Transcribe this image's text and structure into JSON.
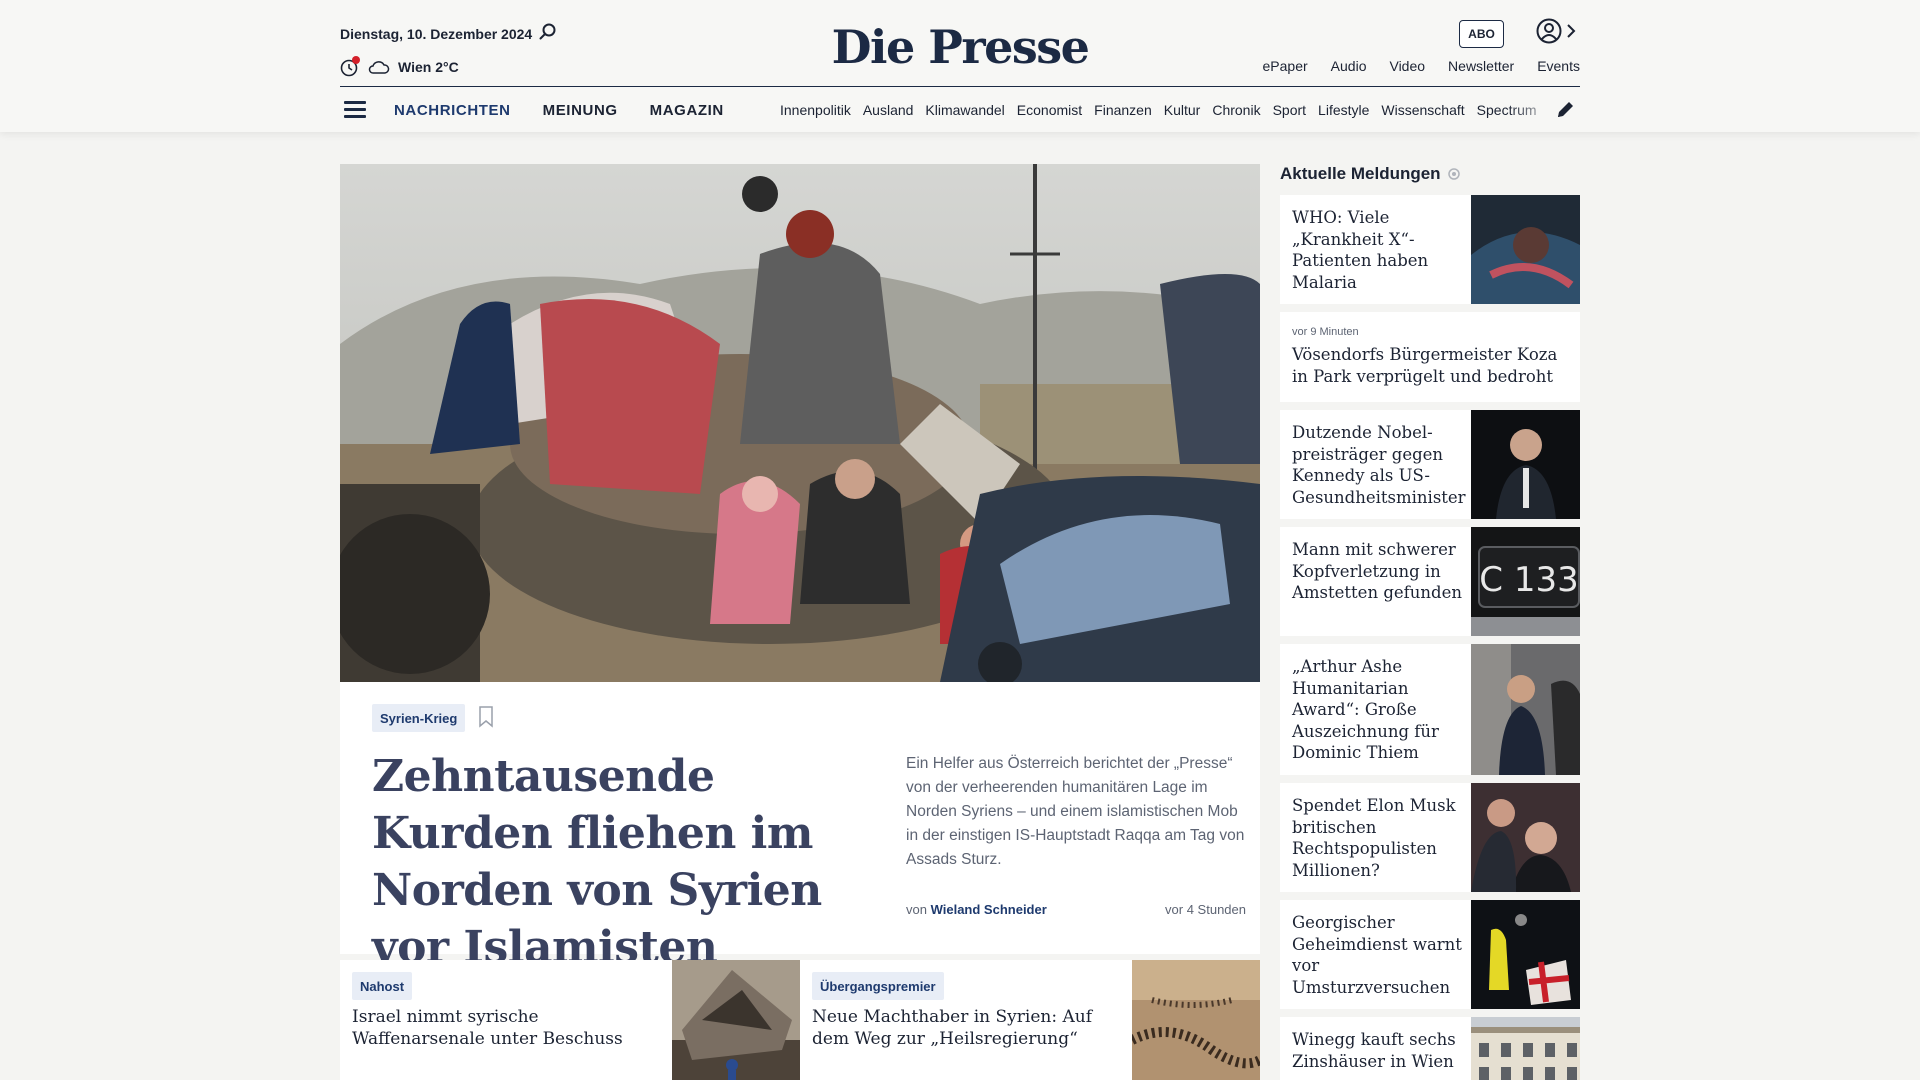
{
  "header": {
    "date": "Dienstag, 10. Dezember 2024",
    "weather_text": "Wien 2°C",
    "logo": "Die Presse",
    "abo": "ABO",
    "top_links": [
      "ePaper",
      "Audio",
      "Video",
      "Newsletter",
      "Events"
    ],
    "main_nav": [
      "NACHRICHTEN",
      "MEINUNG",
      "MAGAZIN"
    ],
    "sub_nav": [
      "Innenpolitik",
      "Ausland",
      "Klimawandel",
      "Economist",
      "Finanzen",
      "Kultur",
      "Chronik",
      "Sport",
      "Lifestyle",
      "Wissenschaft",
      "Spectrum"
    ]
  },
  "hero": {
    "tag": "Syrien-Krieg",
    "headline": "Zehntausende Kurden fliehen im Norden von Syrien vor Islamisten",
    "teaser": "Ein Helfer aus Österreich berichtet der „Presse“ von der verheerenden humanitären Lage im Norden Syriens – und einem islamistischen Mob in der einstigen IS-Hauptstadt Raqqa am Tag von Assads Sturz.",
    "byline_prefix": "von",
    "author": "Wieland Schneider",
    "time": "vor 4 Stunden"
  },
  "cards": [
    {
      "tag": "Nahost",
      "title": "Israel nimmt syrische Waffenarsenale unter Beschuss"
    },
    {
      "tag": "Übergangspremier",
      "title": "Neue Machthaber in Syrien: Auf dem Weg zur „Heilsregierung“"
    }
  ],
  "sidebar": {
    "title": "Aktuelle Meldungen",
    "items": [
      {
        "title": "WHO: Viele „Krankheit X“-Patien­ten haben Malaria",
        "kicker": ""
      },
      {
        "title": "Vösendorfs Bürgermeister Koza in Park verprügelt und bedroht",
        "kicker": "vor 9 Minuten"
      },
      {
        "title": "Dutzende Nobel­preisträger gegen Kennedy als US-Gesundheitsminister",
        "kicker": ""
      },
      {
        "title": "Mann mit schwerer Kopfverletzung in Amstetten gefunden",
        "kicker": ""
      },
      {
        "title": "„Arthur Ashe Humanitarian Award“: Große Auszeichnung für Dominic Thiem",
        "kicker": ""
      },
      {
        "title": "Spendet Elon Musk britischen Rechtspo­pulisten Millionen?",
        "kicker": ""
      },
      {
        "title": "Georgischer Geheimdienst warnt vor Umsturzversuchen",
        "kicker": ""
      },
      {
        "title": "Winegg kauft sechs Zinshäuser in Wien",
        "kicker": ""
      }
    ]
  },
  "plate_text": "C 133",
  "icons": [
    "search-icon",
    "notification-icon",
    "cloud-icon",
    "account-icon",
    "chevron-right-icon",
    "menu-icon",
    "pencil-icon",
    "bookmark-icon",
    "live-icon"
  ]
}
